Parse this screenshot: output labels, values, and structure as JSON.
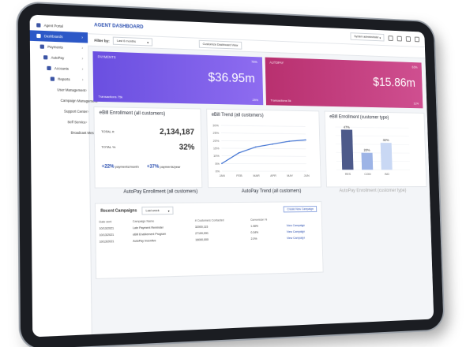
{
  "sidebar": {
    "items": [
      {
        "label": "Agent Portal",
        "active": false
      },
      {
        "label": "Dashboards",
        "active": true
      },
      {
        "label": "Payments",
        "active": false
      },
      {
        "label": "AutoPay",
        "active": false
      },
      {
        "label": "Accounts",
        "active": false
      },
      {
        "label": "Reports",
        "active": false
      },
      {
        "label": "User Management",
        "active": false
      },
      {
        "label": "Campaign Management",
        "active": false
      },
      {
        "label": "Support Center",
        "active": false
      },
      {
        "label": "Self Service",
        "active": false
      },
      {
        "label": "Broadcast Messaging",
        "active": false
      }
    ]
  },
  "header": {
    "title": "AGENT DASHBOARD",
    "user_select": "System administrator"
  },
  "filter": {
    "label": "Filter by:",
    "value": "Last 6 months",
    "customize": "Customize Dashboard View"
  },
  "banners": {
    "payments": {
      "label": "PAYMENTS",
      "pct_top": "75%",
      "amount": "$36.95m",
      "transactions": "Transactions 75k",
      "pct_bottom": "25%"
    },
    "autopay": {
      "label": "AUTOPAY",
      "pct_top": "63%",
      "amount": "$15.86m",
      "transactions": "Transactions 5k",
      "pct_bottom": "11%"
    }
  },
  "ebill_enrollment": {
    "title": "eBill Enrollment (all customers)",
    "total_label": "TOTAL #:",
    "total_value": "2,134,187",
    "pct_label": "TOTAL %:",
    "pct_value": "32%",
    "stat1_value": "+22%",
    "stat1_label": "payments/month",
    "stat2_value": "+37%",
    "stat2_label": "payments/year"
  },
  "ebill_trend": {
    "title": "eBill Trend (all customers)"
  },
  "ebill_type": {
    "title": "eBill Enrollment (customer type)"
  },
  "row2": {
    "a": "AutoPay Enrollment (all customers)",
    "b": "AutoPay Trend (all customers)",
    "c": "AutoPay Enrollment (customer type)"
  },
  "campaigns": {
    "title": "Recent Campaigns",
    "period": "Last week",
    "create_label": "Create New Campaign",
    "columns": [
      "Date sent",
      "Campaign Name",
      "# Customers Contacted",
      "Conversion %",
      ""
    ],
    "rows": [
      {
        "date": "10/13/2021",
        "name": "Late Payment Reminder",
        "contacted": "32000,115",
        "conv": "1.08%",
        "action": "View Campaign"
      },
      {
        "date": "10/13/2021",
        "name": "eBill Enablement Program",
        "contacted": "27100,000",
        "conv": "0.34%",
        "action": "View Campaign"
      },
      {
        "date": "10/13/2021",
        "name": "AutoPay Incentive",
        "contacted": "16000,000",
        "conv": "2.0%",
        "action": "View Campaign"
      }
    ]
  },
  "chart_data": [
    {
      "type": "line",
      "title": "eBill Trend (all customers)",
      "x": [
        "JAN",
        "FEB",
        "MAR",
        "APR",
        "MAY",
        "JUN"
      ],
      "series": [
        {
          "values": [
            5,
            12,
            16,
            18,
            20,
            21
          ]
        }
      ],
      "ylim": [
        0,
        30
      ],
      "yticks": [
        "0%",
        "5%",
        "10%",
        "15%",
        "20%",
        "25%",
        "30%"
      ],
      "grid": true
    },
    {
      "type": "bar",
      "title": "eBill Enrollment (customer type)",
      "categories": [
        "RES",
        "COM",
        "IND"
      ],
      "values": [
        47,
        20,
        32
      ],
      "labels": [
        "47%",
        "20%",
        "32%"
      ],
      "ylim": [
        0,
        50
      ],
      "colors": [
        "#4d5a8a",
        "#9db4e6",
        "#c9d8f4"
      ]
    }
  ]
}
